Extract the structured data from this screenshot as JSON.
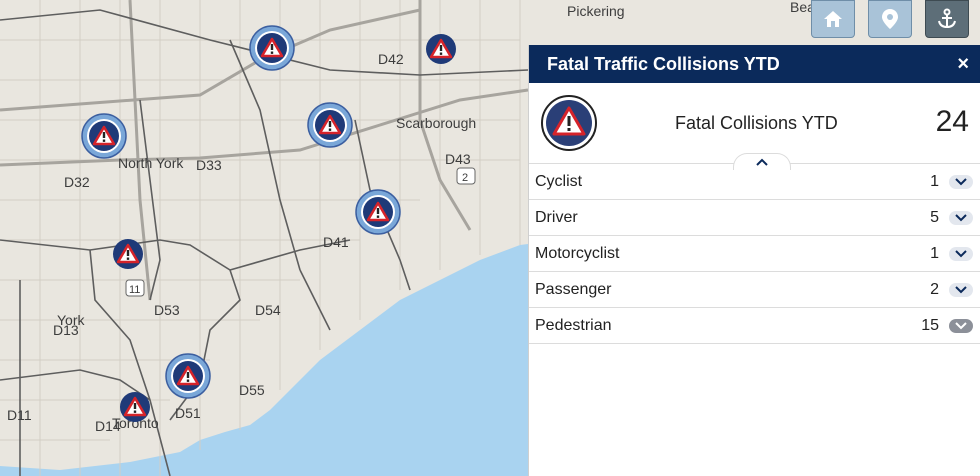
{
  "map": {
    "place_labels": [
      "Pickering",
      "Beach",
      "Scarborough",
      "North York",
      "York",
      "Toronto"
    ],
    "division_labels": [
      "D42",
      "D43",
      "D33",
      "D32",
      "D41",
      "D53",
      "D54",
      "D13",
      "D55",
      "D51",
      "D11",
      "D14"
    ],
    "road_labels": [
      "2",
      "11"
    ],
    "colors": {
      "land": "#e9e6df",
      "water": "#a9d3f0",
      "grid": "#cfcac0",
      "district_border": "#5e5e5e",
      "marker": "#1f3a78",
      "marker_ring": "#7aa7d8"
    }
  },
  "toolbar": {
    "home_icon": "home-icon",
    "pin_icon": "map-pin-icon",
    "anchor_icon": "anchor-icon"
  },
  "panel": {
    "title": "Fatal Traffic Collisions YTD",
    "close": "×",
    "summary_label": "Fatal Collisions YTD",
    "summary_count": "24",
    "rows": [
      {
        "label": "Cyclist",
        "count": "1"
      },
      {
        "label": "Driver",
        "count": "5"
      },
      {
        "label": "Motorcyclist",
        "count": "1"
      },
      {
        "label": "Passenger",
        "count": "2"
      },
      {
        "label": "Pedestrian",
        "count": "15"
      }
    ]
  }
}
